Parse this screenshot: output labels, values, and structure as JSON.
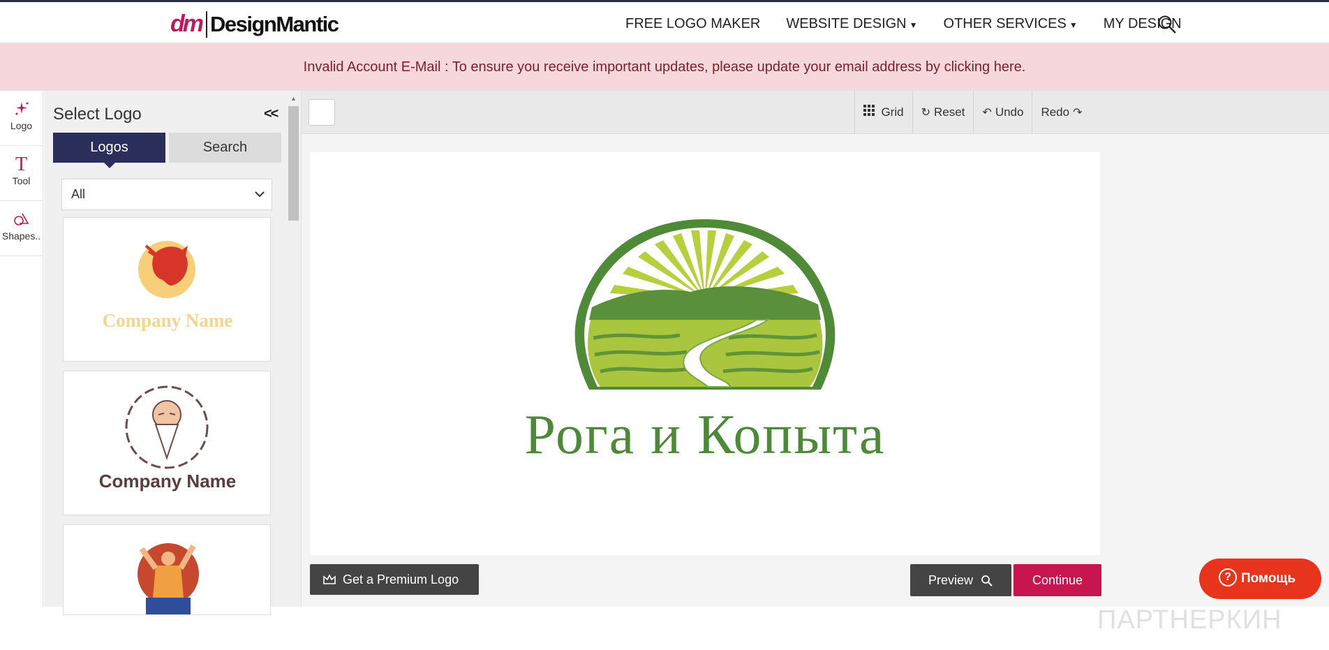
{
  "header": {
    "brand_mark": "dm",
    "brand_name": "DesignMantic",
    "nav": [
      {
        "label": "FREE LOGO MAKER"
      },
      {
        "label": "WEBSITE DESIGN"
      },
      {
        "label": "OTHER SERVICES"
      },
      {
        "label": "MY DESIGN"
      }
    ]
  },
  "alert": {
    "text": "Invalid Account E-Mail : To ensure you receive important updates, please update your email address by clicking here."
  },
  "rail": {
    "items": [
      {
        "label": "Logo",
        "icon": "sparkle-icon"
      },
      {
        "label": "Tool",
        "icon": "text-tool-icon"
      },
      {
        "label": "Shapes..",
        "icon": "shapes-icon"
      }
    ]
  },
  "panel": {
    "title": "Select Logo",
    "collapse": "<<",
    "tabs": [
      {
        "label": "Logos",
        "active": true
      },
      {
        "label": "Search",
        "active": false
      }
    ],
    "filter_value": "All",
    "cards": [
      {
        "caption": "Company Name"
      },
      {
        "caption": "Company Name"
      }
    ]
  },
  "toolbar": {
    "grid": "Grid",
    "reset": "Reset",
    "undo": "Undo",
    "redo": "Redo"
  },
  "canvas": {
    "logo_text": "Рога и Копыта",
    "accent": "#4c8a38"
  },
  "actions": {
    "premium": "Get a Premium Logo",
    "preview": "Preview",
    "continue": "Continue"
  },
  "watermark": "ПАРТНЕРКИН",
  "help": {
    "label": "Помощь"
  },
  "colors": {
    "brand": "#c2185b",
    "nav_dark": "#2b2d5a",
    "continue": "#c8154f",
    "help": "#e8341c",
    "alert_bg": "#f6d8dc"
  }
}
